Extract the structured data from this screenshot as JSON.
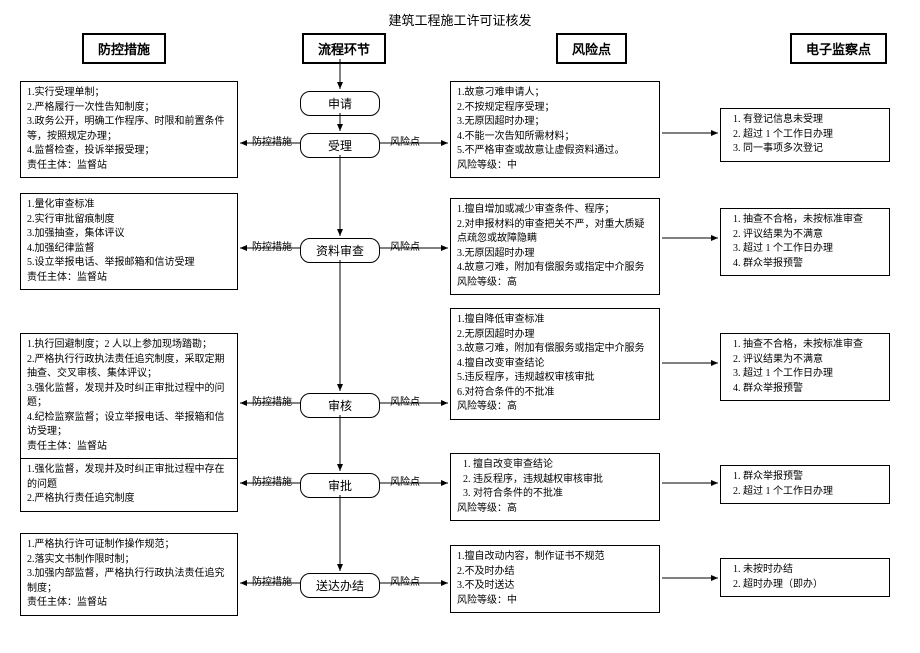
{
  "title": "建筑工程施工许可证核发",
  "headers": {
    "prevention": "防控措施",
    "process": "流程环节",
    "risk": "风险点",
    "monitor": "电子监察点"
  },
  "flow": {
    "apply": "申请",
    "accept": "受理",
    "material": "资料审查",
    "review": "审核",
    "approve": "审批",
    "deliver": "送达办结"
  },
  "labels": {
    "prev": "防控措施",
    "risk": "风险点"
  },
  "prevention": {
    "p1": "1.实行受理单制；\n2.严格履行一次性告知制度；\n3.政务公开，明确工作程序、时限和前置条件等，按照规定办理；\n4.监督检查，投诉举报受理；\n责任主体：监督站",
    "p2": "1.量化审查标准\n2.实行审批留痕制度\n3.加强抽查，集体评议\n4.加强纪律监督\n5.设立举报电话、举报邮箱和信访受理\n责任主体：监督站",
    "p3": "1.执行回避制度；2 人以上参加现场踏勘；\n2.严格执行行政执法责任追究制度，采取定期抽查、交叉审核、集体评议；\n3.强化监督，发现并及时纠正审批过程中的问题；\n4.纪检监察监督；设立举报电话、举报箱和信访受理；\n责任主体：监督站",
    "p4": "1.强化监督，发现并及时纠正审批过程中存在的问题\n2.严格执行责任追究制度",
    "p5": "1.严格执行许可证制作操作规范；\n2.落实文书制作限时制；\n3.加强内部监督，严格执行行政执法责任追究制度；\n责任主体：监督站"
  },
  "risk": {
    "r1": "1.故意刁难申请人；\n2.不按规定程序受理；\n3.无原因超时办理；\n4.不能一次告知所需材料；\n5.不严格审查或故意让虚假资料通过。\n风险等级：中",
    "r2": "1.擅自增加或减少审查条件、程序；\n2.对申报材料的审查把关不严，对重大质疑点疏忽或故障隐瞒\n3.无原因超时办理\n4.故意刁难，附加有偿服务或指定中介服务\n风险等级：高",
    "r3": "1.擅自降低审查标准\n2.无原因超时办理\n3.故意刁难，附加有偿服务或指定中介服务\n4.擅自改变审查结论\n5.违反程序，违规越权审核审批\n6.对符合条件的不批准\n风险等级：高",
    "r4_items": [
      "擅自改变审查结论",
      "违反程序，违规越权审核审批",
      "对符合条件的不批准"
    ],
    "r4_level": "风险等级：高",
    "r5": "1.擅自改动内容，制作证书不规范\n2.不及时办结\n3.不及时送达\n风险等级：中"
  },
  "monitor": {
    "m1": [
      "有登记信息未受理",
      "超过 1 个工作日办理",
      "同一事项多次登记"
    ],
    "m2": [
      "抽查不合格，未按标准审查",
      "评议结果为不满意",
      "超过 1 个工作日办理",
      "群众举报预警"
    ],
    "m3": [
      "抽查不合格，未按标准审查",
      "评议结果为不满意",
      "超过 1 个工作日办理",
      "群众举报预警"
    ],
    "m4": [
      "群众举报预警",
      "超过 1 个工作日办理"
    ],
    "m5": [
      "未按时办结",
      "超时办理（即办）"
    ]
  }
}
